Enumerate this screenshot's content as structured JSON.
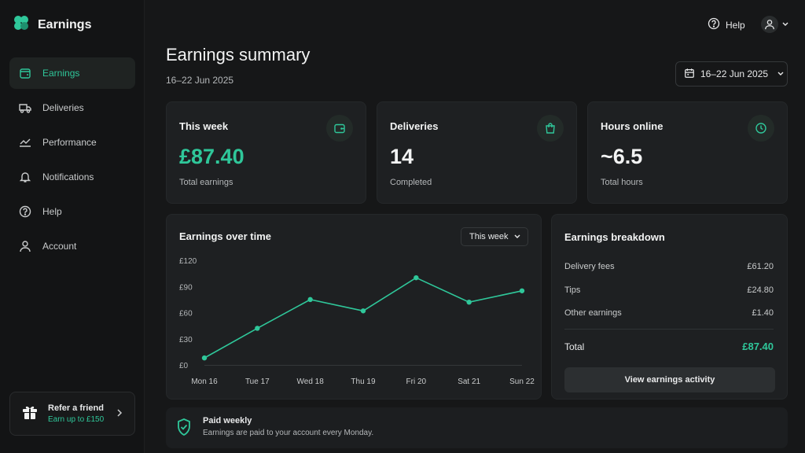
{
  "app": {
    "name": "Earnings"
  },
  "colors": {
    "accent": "#2fc79a",
    "background": "#161718",
    "card": "#1e2022"
  },
  "sidebar": {
    "items": [
      {
        "label": "Earnings",
        "icon": "wallet-icon",
        "active": true
      },
      {
        "label": "Deliveries",
        "icon": "truck-icon",
        "active": false
      },
      {
        "label": "Performance",
        "icon": "trend-icon",
        "active": false
      },
      {
        "label": "Notifications",
        "icon": "bell-icon",
        "active": false
      },
      {
        "label": "Help",
        "icon": "help-icon",
        "active": false
      },
      {
        "label": "Account",
        "icon": "user-icon",
        "active": false
      }
    ],
    "refer": {
      "title": "Refer a friend",
      "subtitle": "Earn up to £150"
    }
  },
  "topbar": {
    "help_label": "Help"
  },
  "header": {
    "title": "Earnings summary",
    "subtitle": "16–22 Jun 2025",
    "date_range": "16–22 Jun 2025"
  },
  "stats": [
    {
      "title": "This week",
      "value": "£87.40",
      "sub": "Total earnings",
      "icon": "wallet-icon"
    },
    {
      "title": "Deliveries",
      "value": "14",
      "sub": "Completed",
      "icon": "bag-icon"
    },
    {
      "title": "Hours online",
      "value": "~6.5",
      "sub": "Total hours",
      "icon": "clock-icon"
    }
  ],
  "earnings_chart": {
    "title": "Earnings over time",
    "period_label": "This week"
  },
  "chart_data": {
    "type": "line",
    "title": "Earnings over time",
    "categories": [
      "Mon 16",
      "Tue 17",
      "Wed 18",
      "Thu 19",
      "Fri 20",
      "Sat 21",
      "Sun 22"
    ],
    "values": [
      8,
      42,
      75,
      62,
      100,
      72,
      85
    ],
    "ylim": [
      0,
      120
    ],
    "yticks": [
      "£0",
      "£30",
      "£60",
      "£90",
      "£120"
    ],
    "grid": false
  },
  "breakdown": {
    "title": "Earnings breakdown",
    "rows": [
      {
        "label": "Delivery fees",
        "value": "£61.20"
      },
      {
        "label": "Tips",
        "value": "£24.80"
      },
      {
        "label": "Other earnings",
        "value": "£1.40"
      }
    ],
    "total_label": "Total",
    "total_value": "£87.40",
    "button_label": "View earnings activity"
  },
  "paid": {
    "title": "Paid weekly",
    "subtitle": "Earnings are paid to your account every Monday."
  }
}
